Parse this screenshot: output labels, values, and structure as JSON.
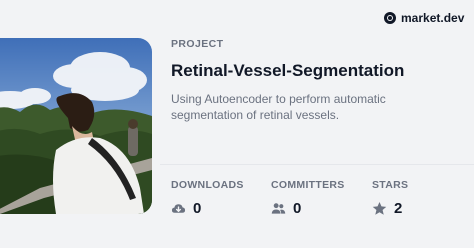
{
  "brand": {
    "name": "market.dev",
    "logo_icon": "market-dev-logo-icon"
  },
  "project": {
    "label": "PROJECT",
    "title": "Retinal-Vessel-Segmentation",
    "description": "Using Autoencoder to perform automatic segmentation of retinal vessels."
  },
  "stats": [
    {
      "label": "DOWNLOADS",
      "value": "0",
      "icon": "cloud-download-icon"
    },
    {
      "label": "COMMITTERS",
      "value": "0",
      "icon": "users-icon"
    },
    {
      "label": "STARS",
      "value": "2",
      "icon": "star-icon"
    }
  ],
  "colors": {
    "background": "#f2f3f5",
    "text": "#111827",
    "muted": "#6b7280"
  }
}
